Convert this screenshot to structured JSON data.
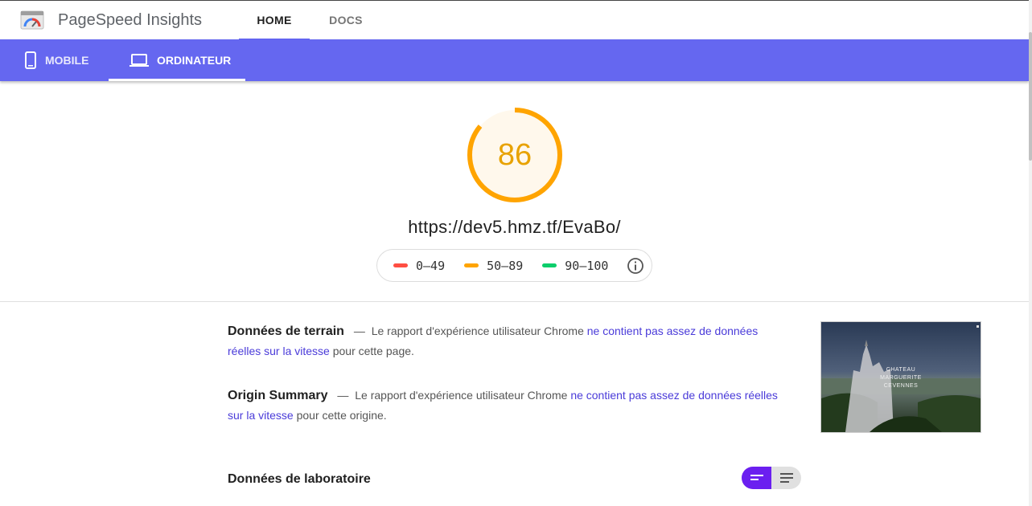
{
  "header": {
    "app_title": "PageSpeed Insights",
    "tabs": [
      {
        "label": "HOME",
        "active": true
      },
      {
        "label": "DOCS",
        "active": false
      }
    ]
  },
  "device_bar": {
    "tabs": [
      {
        "label": "MOBILE",
        "icon": "smartphone-icon",
        "active": false
      },
      {
        "label": "ORDINATEUR",
        "icon": "laptop-icon",
        "active": true
      }
    ],
    "color": "#6567f0"
  },
  "score": {
    "value": "86",
    "fraction": 0.86,
    "color": "#ffa400",
    "url": "https://dev5.hmz.tf/EvaBo/"
  },
  "legend": [
    {
      "range": "0–49",
      "color": "#ff4e42"
    },
    {
      "range": "50–89",
      "color": "#ffa400"
    },
    {
      "range": "90–100",
      "color": "#0cce6b"
    }
  ],
  "field_data": {
    "title": "Données de terrain",
    "dash": "—",
    "text_before": "Le rapport d'expérience utilisateur Chrome",
    "link": "ne contient pas assez de données réelles sur la vitesse",
    "text_after": "pour cette page."
  },
  "origin_summary": {
    "title": "Origin Summary",
    "dash": "—",
    "text_before": "Le rapport d'expérience utilisateur Chrome",
    "link": "ne contient pas assez de données réelles sur la vitesse",
    "text_after": "pour cette origine."
  },
  "screenshot": {
    "lines": [
      "CHATEAU",
      "MARGUERITE",
      "CEVENNES"
    ]
  },
  "lab_data": {
    "title": "Données de laboratoire"
  }
}
